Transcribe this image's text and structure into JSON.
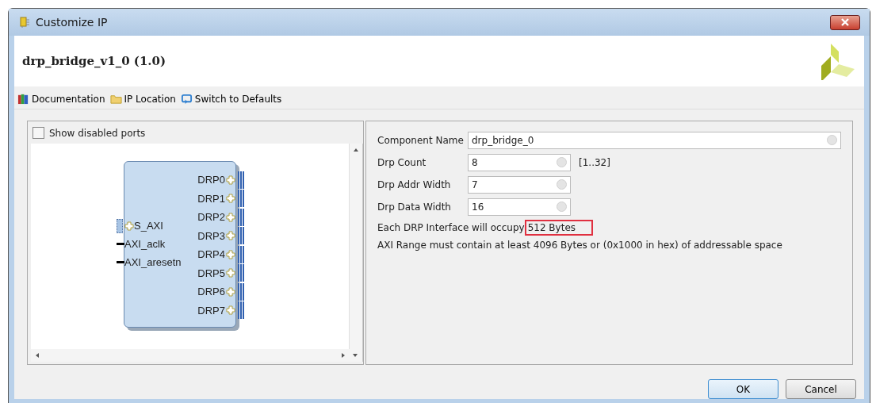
{
  "window": {
    "title": "Customize IP"
  },
  "header": {
    "title": "drp_bridge_v1_0 (1.0)"
  },
  "toolbar": [
    {
      "label": "Documentation",
      "kind": "book"
    },
    {
      "label": "IP Location",
      "kind": "folder"
    },
    {
      "label": "Switch to Defaults",
      "kind": "reset"
    }
  ],
  "left_panel": {
    "show_disabled_ports": {
      "label": "Show disabled ports",
      "checked": false
    },
    "block": {
      "left_ports": [
        {
          "label": "S_AXI",
          "kind": "bus"
        },
        {
          "label": "AXI_aclk",
          "kind": "wire"
        },
        {
          "label": "AXI_aresetn",
          "kind": "wire"
        }
      ],
      "right_ports": [
        {
          "label": "DRP0",
          "kind": "bus"
        },
        {
          "label": "DRP1",
          "kind": "bus"
        },
        {
          "label": "DRP2",
          "kind": "bus"
        },
        {
          "label": "DRP3",
          "kind": "bus"
        },
        {
          "label": "DRP4",
          "kind": "bus"
        },
        {
          "label": "DRP5",
          "kind": "bus"
        },
        {
          "label": "DRP6",
          "kind": "bus"
        },
        {
          "label": "DRP7",
          "kind": "bus"
        }
      ]
    }
  },
  "right_panel": {
    "fields": [
      {
        "label": "Component Name",
        "value": "drp_bridge_0",
        "wide": true
      },
      {
        "label": "Drp Count",
        "value": "8",
        "range": "[1..32]",
        "wide": false
      },
      {
        "label": "Drp Addr Width",
        "value": "7",
        "wide": false
      },
      {
        "label": "Drp Data Width",
        "value": "16",
        "wide": false
      }
    ],
    "occupy": {
      "text": "Each DRP Interface will occupy",
      "value": "512 Bytes",
      "highlighted": true
    },
    "note": "AXI Range must contain at least 4096 Bytes or (0x1000 in hex) of addressable space"
  },
  "buttons": [
    {
      "label": "OK",
      "default": true
    },
    {
      "label": "Cancel",
      "default": false
    }
  ]
}
